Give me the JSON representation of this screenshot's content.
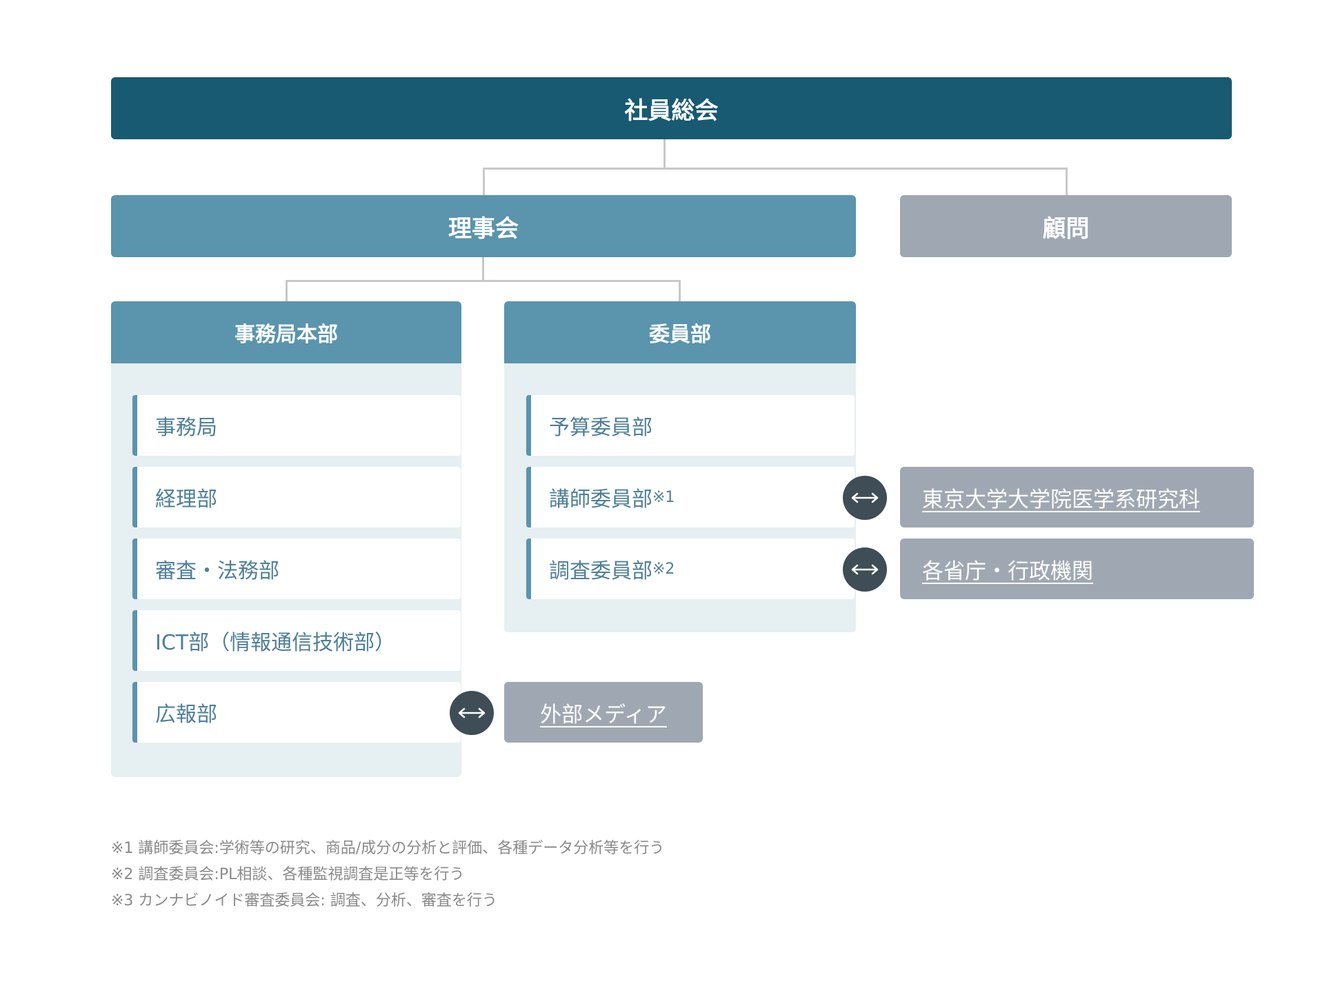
{
  "chart": {
    "top": "社員総会",
    "board": "理事会",
    "advisor": "顧問",
    "secretariat": {
      "title": "事務局本部",
      "items": [
        "事務局",
        "経理部",
        "審査・法務部",
        "ICT部（情報通信技術部）",
        "広報部"
      ]
    },
    "committee": {
      "title": "委員部",
      "items": [
        {
          "label": "予算委員部",
          "note": ""
        },
        {
          "label": "講師委員部",
          "note": "※1"
        },
        {
          "label": "調査委員部",
          "note": "※2"
        }
      ]
    },
    "external": {
      "university": "東京大学大学院医学系研究科",
      "ministries": "各省庁・行政機関",
      "media": "外部メディア"
    }
  },
  "notes": [
    "※1 講師委員会:学術等の研究、商品/成分の分析と評価、各種データ分析等を行う",
    "※2 調査委員会:PL相談、各種監視調査是正等を行う",
    "※3 カンナビノイド審査委員会: 調査、分析、審査を行う"
  ],
  "colors": {
    "dark_teal": "#185a71",
    "mid_teal": "#5a94ad",
    "gray": "#9fa8b2",
    "panel_bg": "#e6eff2",
    "connector": "#c8c8c8",
    "arrow_bg": "#3e4d56"
  },
  "icons": {
    "link_arrow": "double-arrow-icon"
  }
}
